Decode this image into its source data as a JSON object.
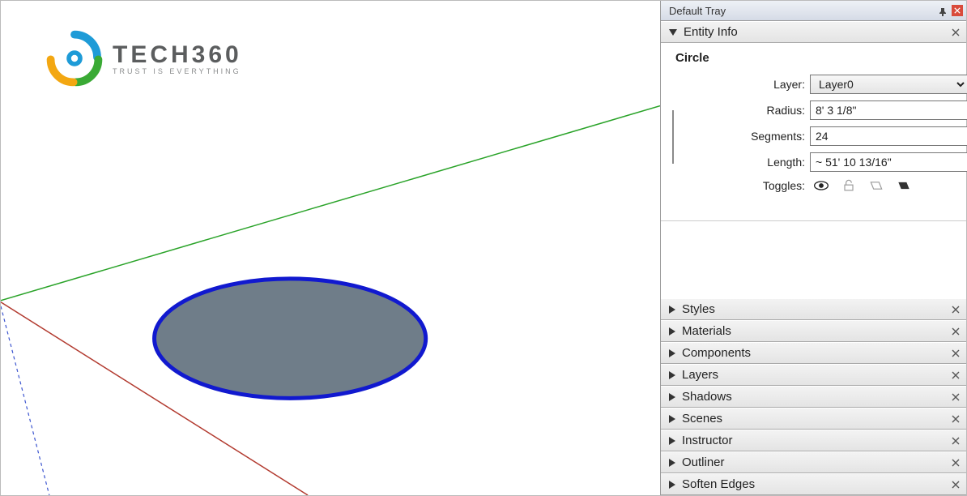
{
  "logo": {
    "title": "TECH360",
    "sub": "TRUST IS EVERYTHING"
  },
  "tray": {
    "title": "Default Tray"
  },
  "entity_info": {
    "panel_title": "Entity Info",
    "type": "Circle",
    "labels": {
      "layer": "Layer:",
      "radius": "Radius:",
      "segments": "Segments:",
      "length": "Length:",
      "toggles": "Toggles:"
    },
    "layer_value": "Layer0",
    "radius_value": "8' 3 1/8\"",
    "segments_value": "24",
    "length_value": "~ 51' 10 13/16\""
  },
  "panels": [
    {
      "title": "Styles"
    },
    {
      "title": "Materials"
    },
    {
      "title": "Components"
    },
    {
      "title": "Layers"
    },
    {
      "title": "Shadows"
    },
    {
      "title": "Scenes"
    },
    {
      "title": "Instructor"
    },
    {
      "title": "Outliner"
    },
    {
      "title": "Soften Edges"
    }
  ]
}
